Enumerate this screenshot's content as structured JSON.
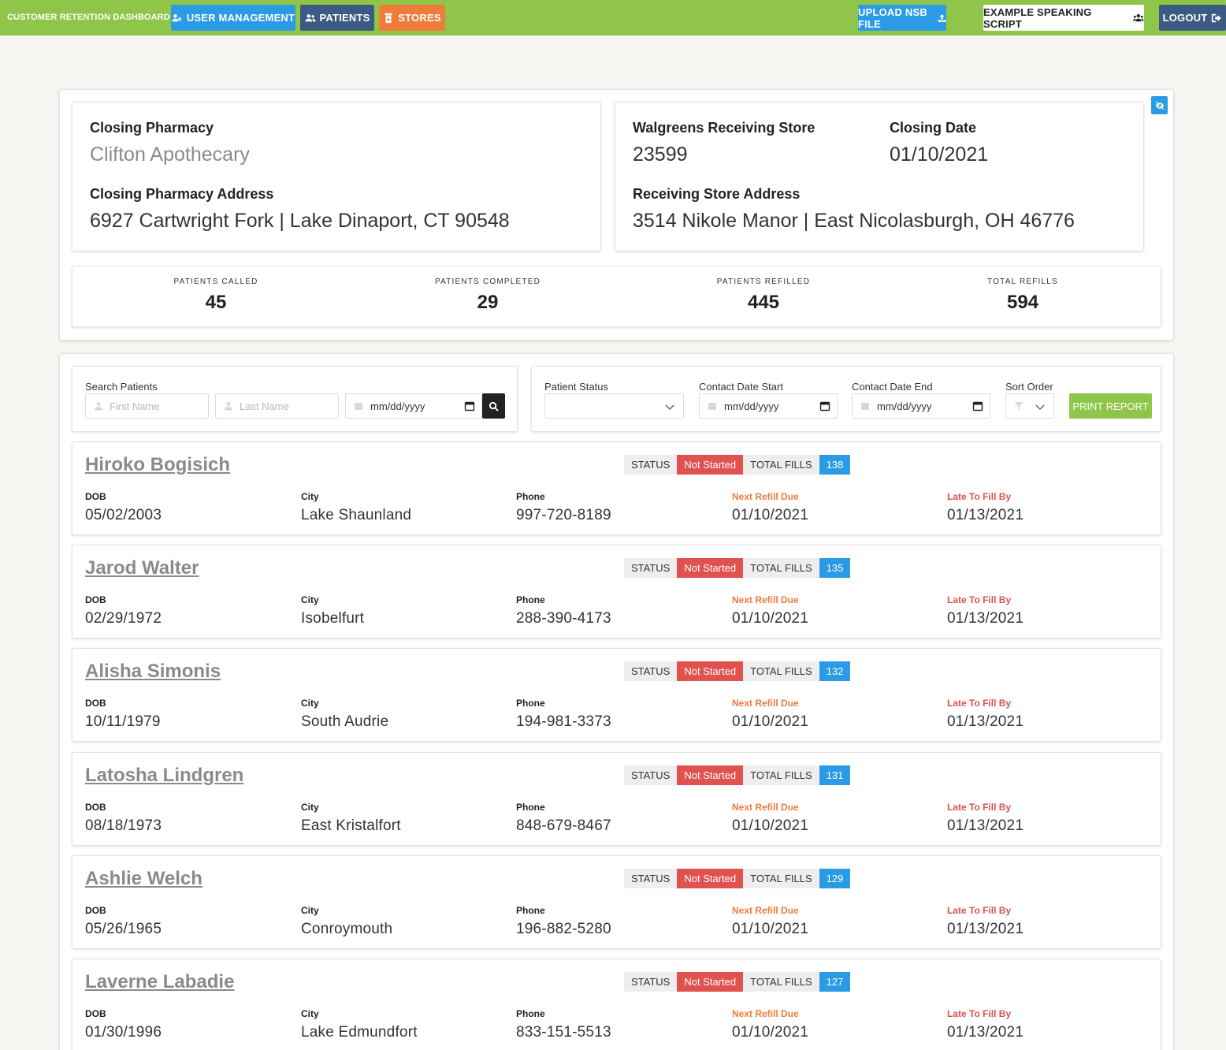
{
  "nav": {
    "brand": "CUSTOMER RETENTION DASHBOARD",
    "user_management": "USER MANAGEMENT",
    "patients": "PATIENTS",
    "stores": "STORES",
    "upload": "UPLOAD NSB FILE",
    "script": "EXAMPLE SPEAKING SCRIPT",
    "logout": "LOGOUT"
  },
  "store": {
    "closing_pharmacy_label": "Closing Pharmacy",
    "closing_pharmacy": "Clifton Apothecary",
    "closing_address_label": "Closing Pharmacy Address",
    "closing_address": "6927 Cartwright Fork | Lake Dinaport, CT 90548",
    "receiving_store_label": "Walgreens Receiving Store",
    "receiving_store": "23599",
    "closing_date_label": "Closing Date",
    "closing_date": "01/10/2021",
    "receiving_address_label": "Receiving Store Address",
    "receiving_address": "3514 Nikole Manor | East Nicolasburgh, OH 46776"
  },
  "stats": [
    {
      "label": "PATIENTS CALLED",
      "value": "45"
    },
    {
      "label": "PATIENTS COMPLETED",
      "value": "29"
    },
    {
      "label": "PATIENTS REFILLED",
      "value": "445"
    },
    {
      "label": "TOTAL REFILLS",
      "value": "594"
    }
  ],
  "filters": {
    "search_label": "Search Patients",
    "first_name_placeholder": "First Name",
    "last_name_placeholder": "Last Name",
    "date_placeholder": "mm/dd/yyyy",
    "status_label": "Patient Status",
    "contact_start_label": "Contact Date Start",
    "contact_end_label": "Contact Date End",
    "sort_label": "Sort Order",
    "print": "PRINT REPORT"
  },
  "field_labels": {
    "dob": "DOB",
    "city": "City",
    "phone": "Phone",
    "next_refill": "Next Refill Due",
    "late_to_fill": "Late To Fill By",
    "status": "STATUS",
    "total_fills": "TOTAL FILLS"
  },
  "patients": [
    {
      "name": "Hiroko Bogisich",
      "status": "Not Started",
      "fills": "138",
      "dob": "05/02/2003",
      "city": "Lake Shaunland",
      "phone": "997-720-8189",
      "next_refill": "01/10/2021",
      "late_to_fill": "01/13/2021"
    },
    {
      "name": "Jarod Walter",
      "status": "Not Started",
      "fills": "135",
      "dob": "02/29/1972",
      "city": "Isobelfurt",
      "phone": "288-390-4173",
      "next_refill": "01/10/2021",
      "late_to_fill": "01/13/2021"
    },
    {
      "name": "Alisha Simonis",
      "status": "Not Started",
      "fills": "132",
      "dob": "10/11/1979",
      "city": "South Audrie",
      "phone": "194-981-3373",
      "next_refill": "01/10/2021",
      "late_to_fill": "01/13/2021"
    },
    {
      "name": "Latosha Lindgren",
      "status": "Not Started",
      "fills": "131",
      "dob": "08/18/1973",
      "city": "East Kristalfort",
      "phone": "848-679-8467",
      "next_refill": "01/10/2021",
      "late_to_fill": "01/13/2021"
    },
    {
      "name": "Ashlie Welch",
      "status": "Not Started",
      "fills": "129",
      "dob": "05/26/1965",
      "city": "Conroymouth",
      "phone": "196-882-5280",
      "next_refill": "01/10/2021",
      "late_to_fill": "01/13/2021"
    },
    {
      "name": "Laverne Labadie",
      "status": "Not Started",
      "fills": "127",
      "dob": "01/30/1996",
      "city": "Lake Edmundfort",
      "phone": "833-151-5513",
      "next_refill": "01/10/2021",
      "late_to_fill": "01/13/2021"
    }
  ]
}
